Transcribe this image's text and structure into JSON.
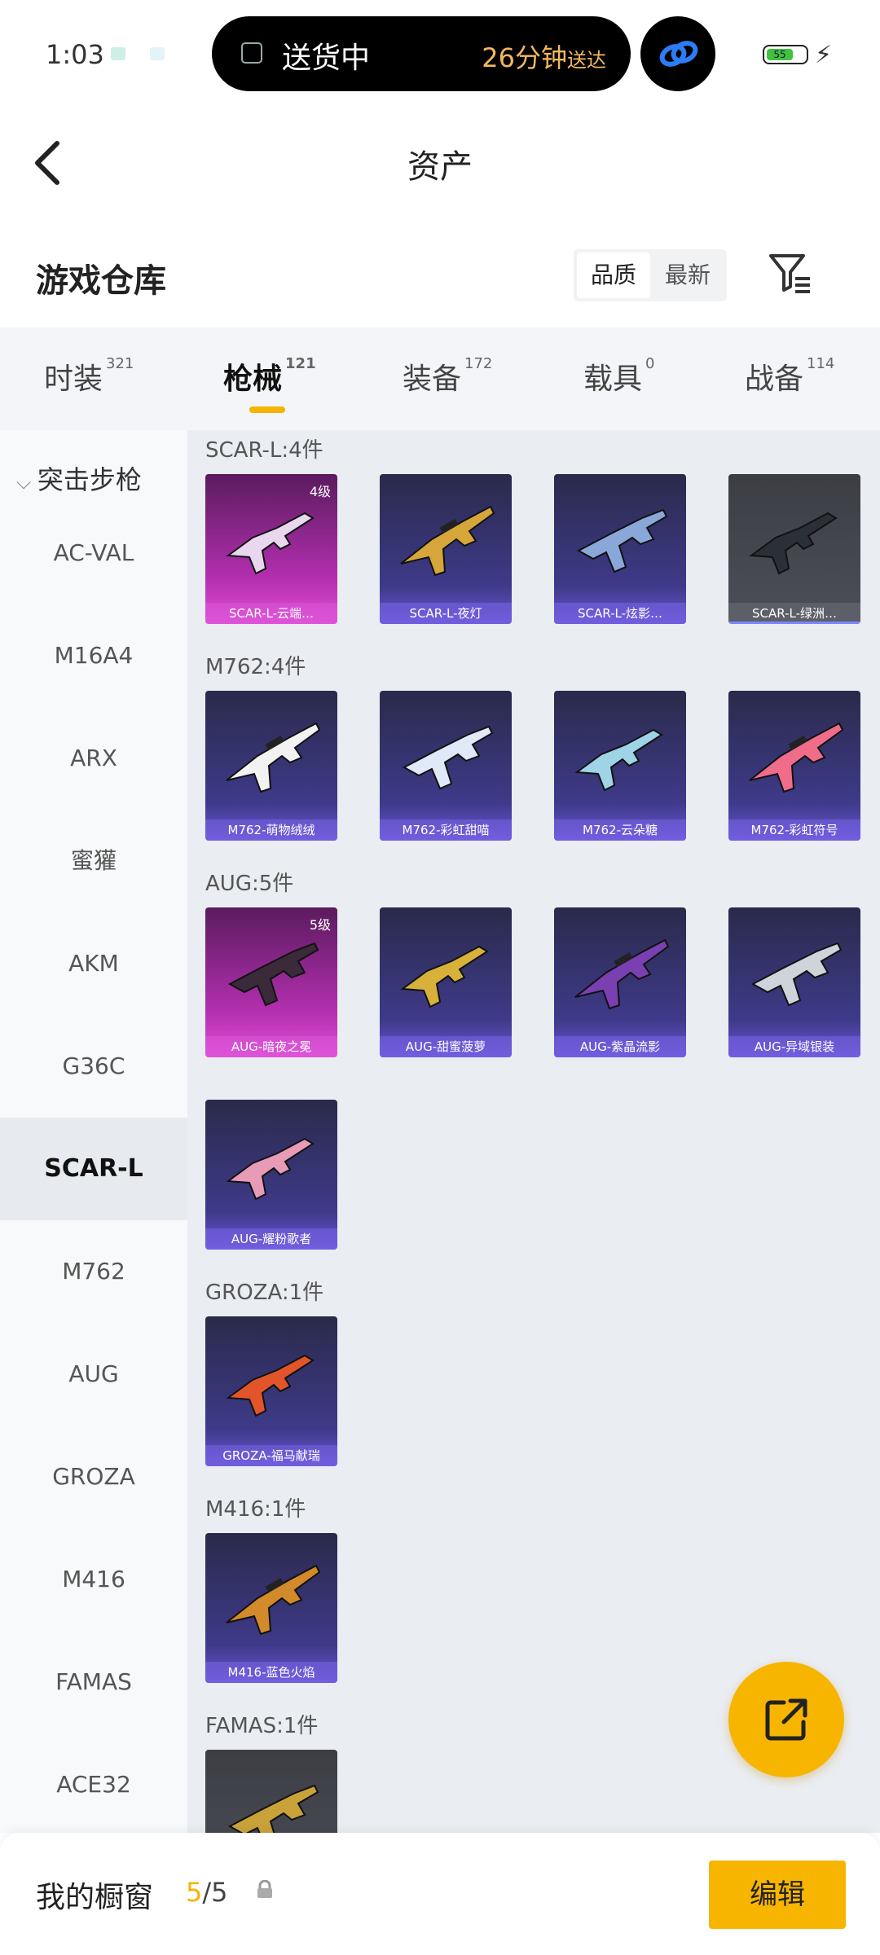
{
  "status_bar": {
    "time": "1:03",
    "island_text": "送货中",
    "island_eta": "26分钟",
    "island_eta_suffix": "送达",
    "battery_level": "55"
  },
  "header": {
    "title": "资产"
  },
  "warehouse": {
    "title": "游戏仓库",
    "sort_options": [
      "品质",
      "最新"
    ]
  },
  "tabs": [
    {
      "label": "时装",
      "count": "321"
    },
    {
      "label": "枪械",
      "count": "121",
      "active": true
    },
    {
      "label": "装备",
      "count": "172"
    },
    {
      "label": "载具",
      "count": "0"
    },
    {
      "label": "战备",
      "count": "114"
    }
  ],
  "sidebar": {
    "category": "突击步枪",
    "items": [
      "AC-VAL",
      "M16A4",
      "ARX",
      "蜜獾",
      "AKM",
      "G36C",
      "SCAR-L",
      "M762",
      "AUG",
      "GROZA",
      "M416",
      "FAMAS",
      "ACE32"
    ],
    "active": "SCAR-L"
  },
  "groups": [
    {
      "title": "SCAR-L:4件",
      "items": [
        {
          "name": "SCAR-L-云端…",
          "level": "4级",
          "style": "purple",
          "color": "#e8d7ee"
        },
        {
          "name": "SCAR-L-夜灯",
          "style": "blue",
          "color": "#d7a63a"
        },
        {
          "name": "SCAR-L-炫影…",
          "style": "blue",
          "color": "#8aa7d9"
        },
        {
          "name": "SCAR-L-绿洲…",
          "style": "grey",
          "color": "#2b2f36"
        }
      ]
    },
    {
      "title": "M762:4件",
      "items": [
        {
          "name": "M762-萌物绒绒",
          "style": "blue",
          "color": "#f2f2f2"
        },
        {
          "name": "M762-彩虹甜喵",
          "style": "blue",
          "color": "#dfe9f7"
        },
        {
          "name": "M762-云朵糖",
          "style": "blue",
          "color": "#9fd3e6"
        },
        {
          "name": "M762-彩虹符号",
          "style": "blue",
          "color": "#ef6d8a"
        }
      ]
    },
    {
      "title": "AUG:5件",
      "items": [
        {
          "name": "AUG-暗夜之冕",
          "level": "5级",
          "style": "purple",
          "color": "#3a2a3a"
        },
        {
          "name": "AUG-甜蜜菠萝",
          "style": "blue",
          "color": "#d8b13a"
        },
        {
          "name": "AUG-紫晶流影",
          "style": "blue",
          "color": "#7a3fb0"
        },
        {
          "name": "AUG-异域银装",
          "style": "blue",
          "color": "#cfd3da"
        },
        {
          "name": "AUG-耀粉歌者",
          "style": "blue",
          "color": "#e79bb7"
        }
      ]
    },
    {
      "title": "GROZA:1件",
      "items": [
        {
          "name": "GROZA-福马献瑞",
          "style": "blue",
          "color": "#e2552a"
        }
      ]
    },
    {
      "title": "M416:1件",
      "items": [
        {
          "name": "M416-蓝色火焰",
          "style": "blue",
          "color": "#d28a2a"
        }
      ]
    },
    {
      "title": "FAMAS:1件",
      "items": [
        {
          "name": "",
          "style": "grey",
          "color": "#c9a23a"
        }
      ]
    }
  ],
  "bottom": {
    "window_label": "我的橱窗",
    "window_current": "5",
    "window_total": "/5",
    "edit_label": "编辑"
  }
}
